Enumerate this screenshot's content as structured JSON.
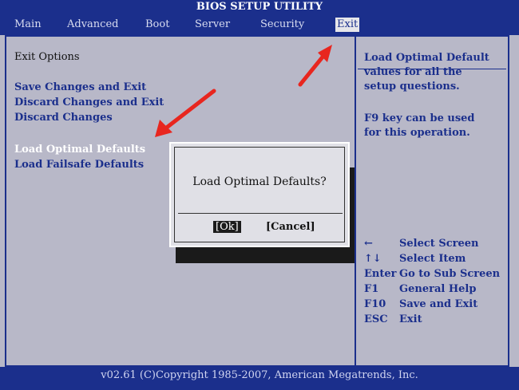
{
  "title": "BIOS SETUP UTILITY",
  "menu": [
    "Main",
    "Advanced",
    "Boot",
    "Server",
    "Security",
    "Exit"
  ],
  "active_menu": "Exit",
  "section_title": "Exit Options",
  "options": [
    "Save Changes and Exit",
    "Discard Changes and Exit",
    "Discard Changes",
    "Load Optimal Defaults",
    "Load Failsafe Defaults"
  ],
  "help": {
    "line1": "Load Optimal Default",
    "line2": "values for all the",
    "line3": "setup questions.",
    "line4": "F9 key can be used",
    "line5": "for this operation."
  },
  "keys": [
    {
      "key": "←",
      "desc": "Select Screen"
    },
    {
      "key": "↑↓",
      "desc": "Select Item"
    },
    {
      "key": "Enter",
      "desc": "Go to Sub Screen"
    },
    {
      "key": "F1",
      "desc": "General Help"
    },
    {
      "key": "F10",
      "desc": "Save and Exit"
    },
    {
      "key": "ESC",
      "desc": "Exit"
    }
  ],
  "dialog": {
    "message": "Load Optimal Defaults?",
    "ok": "[Ok]",
    "cancel": "[Cancel]"
  },
  "footer": "v02.61 (C)Copyright 1985-2007, American Megatrends, Inc.",
  "colors": {
    "bios_blue": "#1b2f8c",
    "panel_gray": "#b8b8c8",
    "arrow_red": "#e8261f"
  }
}
